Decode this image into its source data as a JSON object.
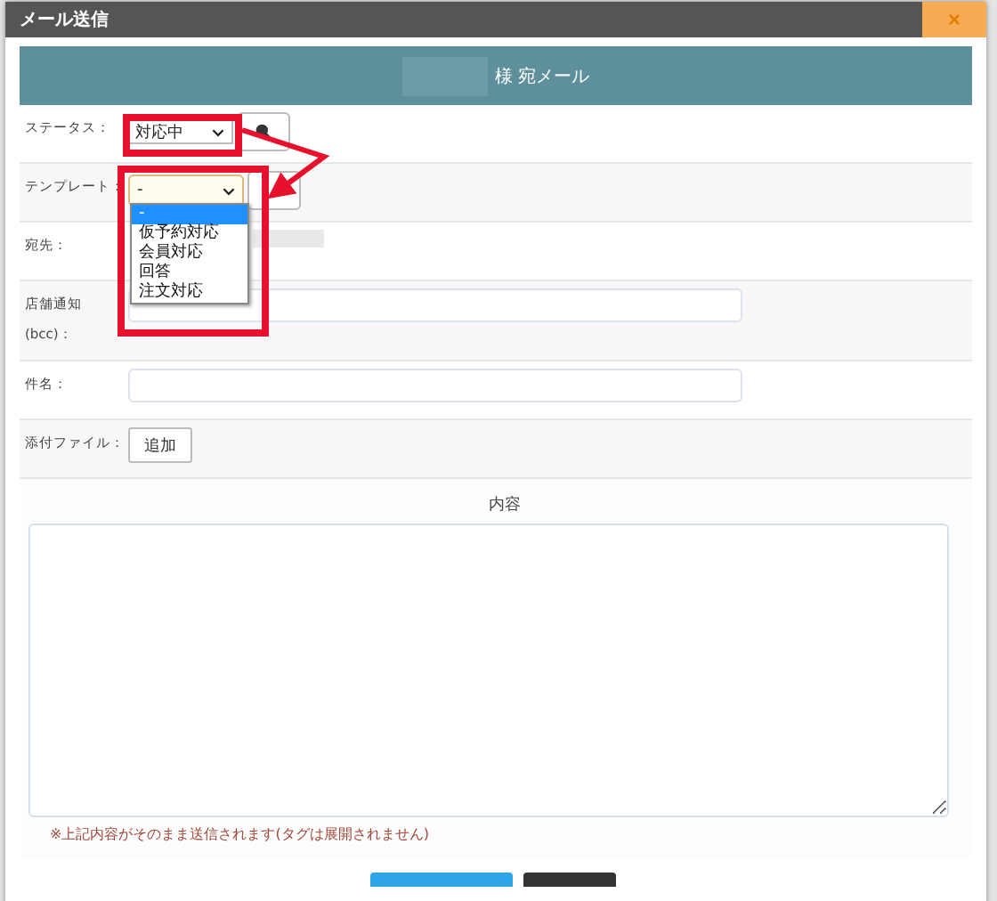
{
  "window": {
    "title": "メール送信",
    "close_label": "×"
  },
  "header": {
    "title": "様 宛メール"
  },
  "status": {
    "label": "ステータス：",
    "value": "対応中"
  },
  "template": {
    "label": "テンプレート：",
    "value": "-",
    "expanded": true,
    "options": [
      {
        "label": "-",
        "selected": true
      },
      {
        "label": "仮予約対応",
        "selected": false
      },
      {
        "label": "会員対応",
        "selected": false
      },
      {
        "label": "回答",
        "selected": false
      },
      {
        "label": "注文対応",
        "selected": false
      }
    ]
  },
  "recipient": {
    "label": "宛先："
  },
  "bcc": {
    "label_lines": [
      "店舗通知",
      "(bcc)："
    ]
  },
  "subject": {
    "label": "件名："
  },
  "attachment": {
    "label": "添付ファイル：",
    "button": "追加"
  },
  "body": {
    "label": "内容",
    "note": "※上記内容がそのまま送信されます(タグは展開されません)"
  }
}
